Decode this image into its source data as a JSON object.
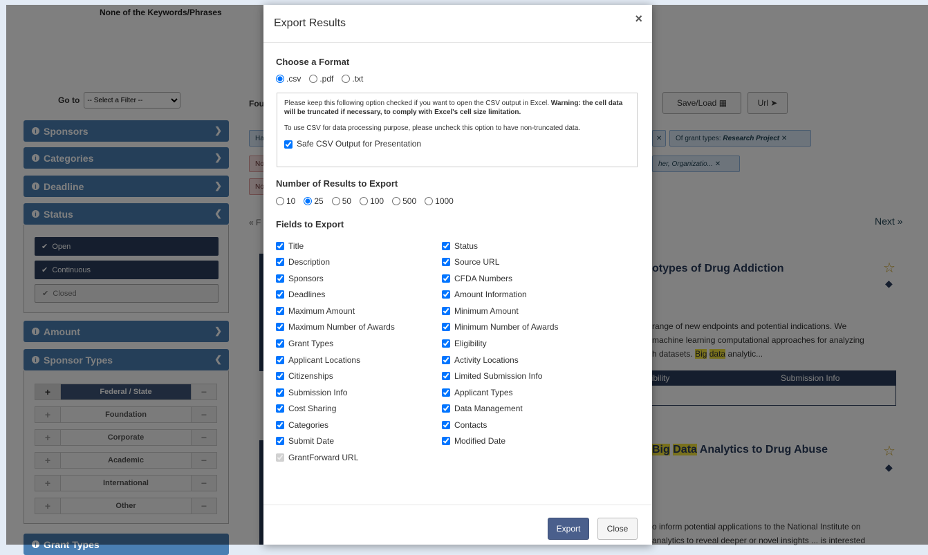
{
  "sidebar": {
    "keywords_heading": "None of the Keywords/Phrases",
    "goto_label": "Go to",
    "goto_select": "-- Select a Filter --",
    "panels": {
      "sponsors": "Sponsors",
      "categories": "Categories",
      "deadline": "Deadline",
      "status": "Status",
      "amount": "Amount",
      "sponsor_types": "Sponsor Types",
      "grant_types": "Grant Types"
    },
    "status_options": [
      "Open",
      "Continuous",
      "Closed"
    ],
    "sponsor_types": [
      "Federal / State",
      "Foundation",
      "Corporate",
      "Academic",
      "International",
      "Other"
    ]
  },
  "main": {
    "found_label": "Fou",
    "save_load": "Save/Load",
    "url": "Url",
    "tag_grant_types_prefix": "Of grant types:",
    "tag_grant_types_value": "Research Project",
    "tag_other": "her, Organizatio...",
    "tag_ha": "Ha",
    "tag_no1": "No",
    "tag_no2": "No",
    "prev": "« F",
    "next": "Next »",
    "result1_title": "otypes of Drug Addiction",
    "result1_text1": "range of new endpoints and potential indications. We",
    "result1_text2": "machine learning computational approaches for analyzing",
    "result1_text3_a": "h datasets.",
    "result1_hl1": "Big",
    "result1_hl2": "data",
    "result1_text3_b": "analytic...",
    "table_col1": "jibility",
    "table_col2": "Submission Info",
    "result2_hl1": "Big",
    "result2_hl2": "Data",
    "result2_title": "Analytics to Drug Abuse",
    "result2_text1": "o inform potential applications to the National Institute on",
    "result2_text2": "analytics to reveal deeper or novel insights ... is interested"
  },
  "modal": {
    "title": "Export Results",
    "close_x": "×",
    "format_title": "Choose a Format",
    "formats": [
      ".csv",
      ".pdf",
      ".txt"
    ],
    "selected_format": ".csv",
    "info_text1": "Please keep this following option checked if you want to open the CSV output in Excel.",
    "info_warning": "Warning: the cell data will be truncated if necessary, to comply with Excel's cell size limitation.",
    "info_text2": "To use CSV for data processing purpose, please uncheck this option to have non-truncated data.",
    "safe_csv_label": "Safe CSV Output for Presentation",
    "results_title": "Number of Results to Export",
    "result_counts": [
      "10",
      "25",
      "50",
      "100",
      "500",
      "1000"
    ],
    "selected_count": "25",
    "fields_title": "Fields to Export",
    "fields_left": [
      "Title",
      "Description",
      "Sponsors",
      "Deadlines",
      "Maximum Amount",
      "Maximum Number of Awards",
      "Grant Types",
      "Applicant Locations",
      "Citizenships",
      "Submission Info",
      "Cost Sharing",
      "Categories",
      "Submit Date",
      "GrantForward URL"
    ],
    "fields_right": [
      "Status",
      "Source URL",
      "CFDA Numbers",
      "Amount Information",
      "Minimum Amount",
      "Minimum Number of Awards",
      "Eligibility",
      "Activity Locations",
      "Limited Submission Info",
      "Applicant Types",
      "Data Management",
      "Contacts",
      "Modified Date"
    ],
    "export_button": "Export",
    "close_button": "Close"
  },
  "colors": {
    "panel_blue": "#4a7fb3",
    "navy": "#2a3d5c",
    "export_button": "#4a5f8c",
    "highlight": "#f2e33a"
  }
}
